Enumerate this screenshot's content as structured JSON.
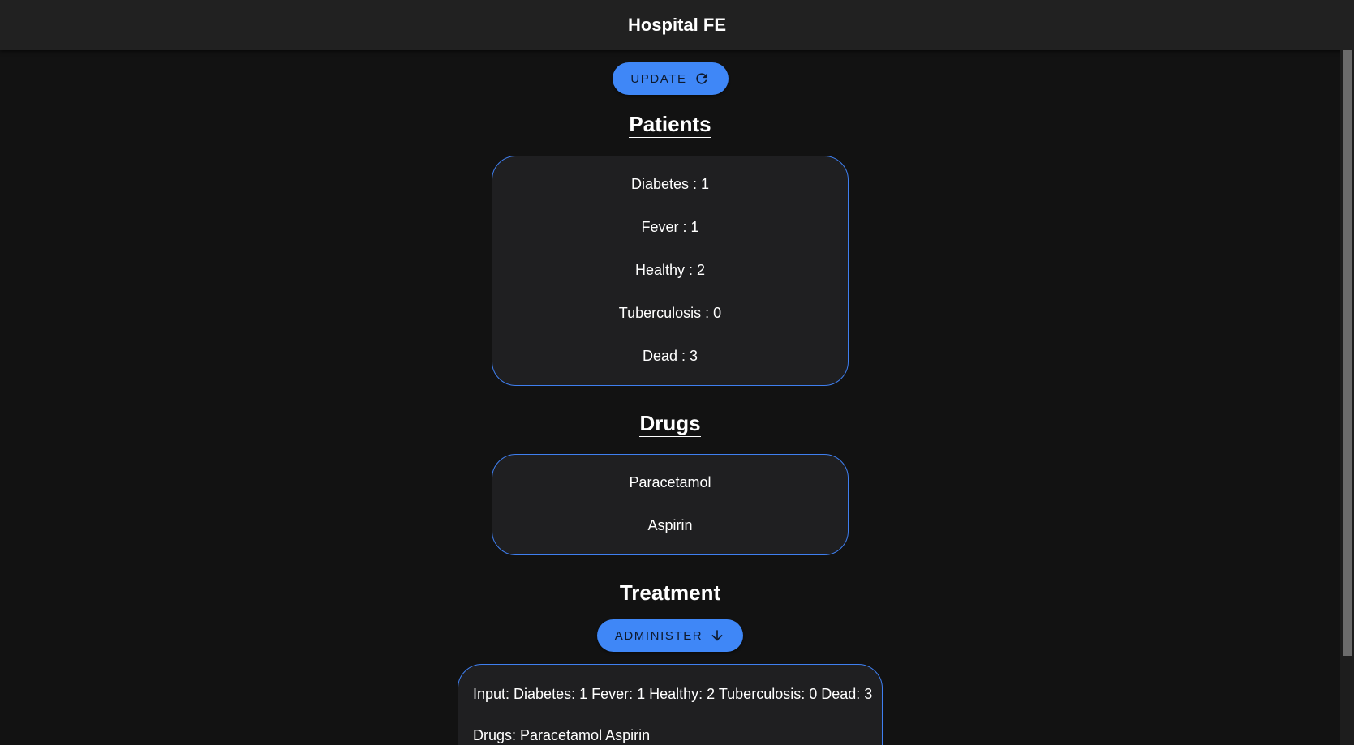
{
  "app_bar": {
    "title": "Hospital FE"
  },
  "update_button": {
    "label": "UPDATE",
    "icon": "refresh-icon"
  },
  "patients": {
    "heading": "Patients",
    "items": [
      {
        "label": "Diabetes : 1"
      },
      {
        "label": "Fever : 1"
      },
      {
        "label": "Healthy : 2"
      },
      {
        "label": "Tuberculosis : 0"
      },
      {
        "label": "Dead : 3"
      }
    ]
  },
  "drugs": {
    "heading": "Drugs",
    "items": [
      {
        "label": "Paracetamol"
      },
      {
        "label": "Aspirin"
      }
    ]
  },
  "treatment": {
    "heading": "Treatment",
    "administer_label": "ADMINISTER",
    "administer_icon": "arrow-down-icon",
    "input_line": "Input: Diabetes: 1 Fever: 1 Healthy: 2 Tuberculosis: 0 Dead: 3",
    "drugs_line": "Drugs: Paracetamol Aspirin"
  },
  "colors": {
    "background": "#121212",
    "app_bar": "#212121",
    "accent": "#3f87f7",
    "card_border": "#3f7ff0",
    "card_background": "#1f1f21"
  }
}
